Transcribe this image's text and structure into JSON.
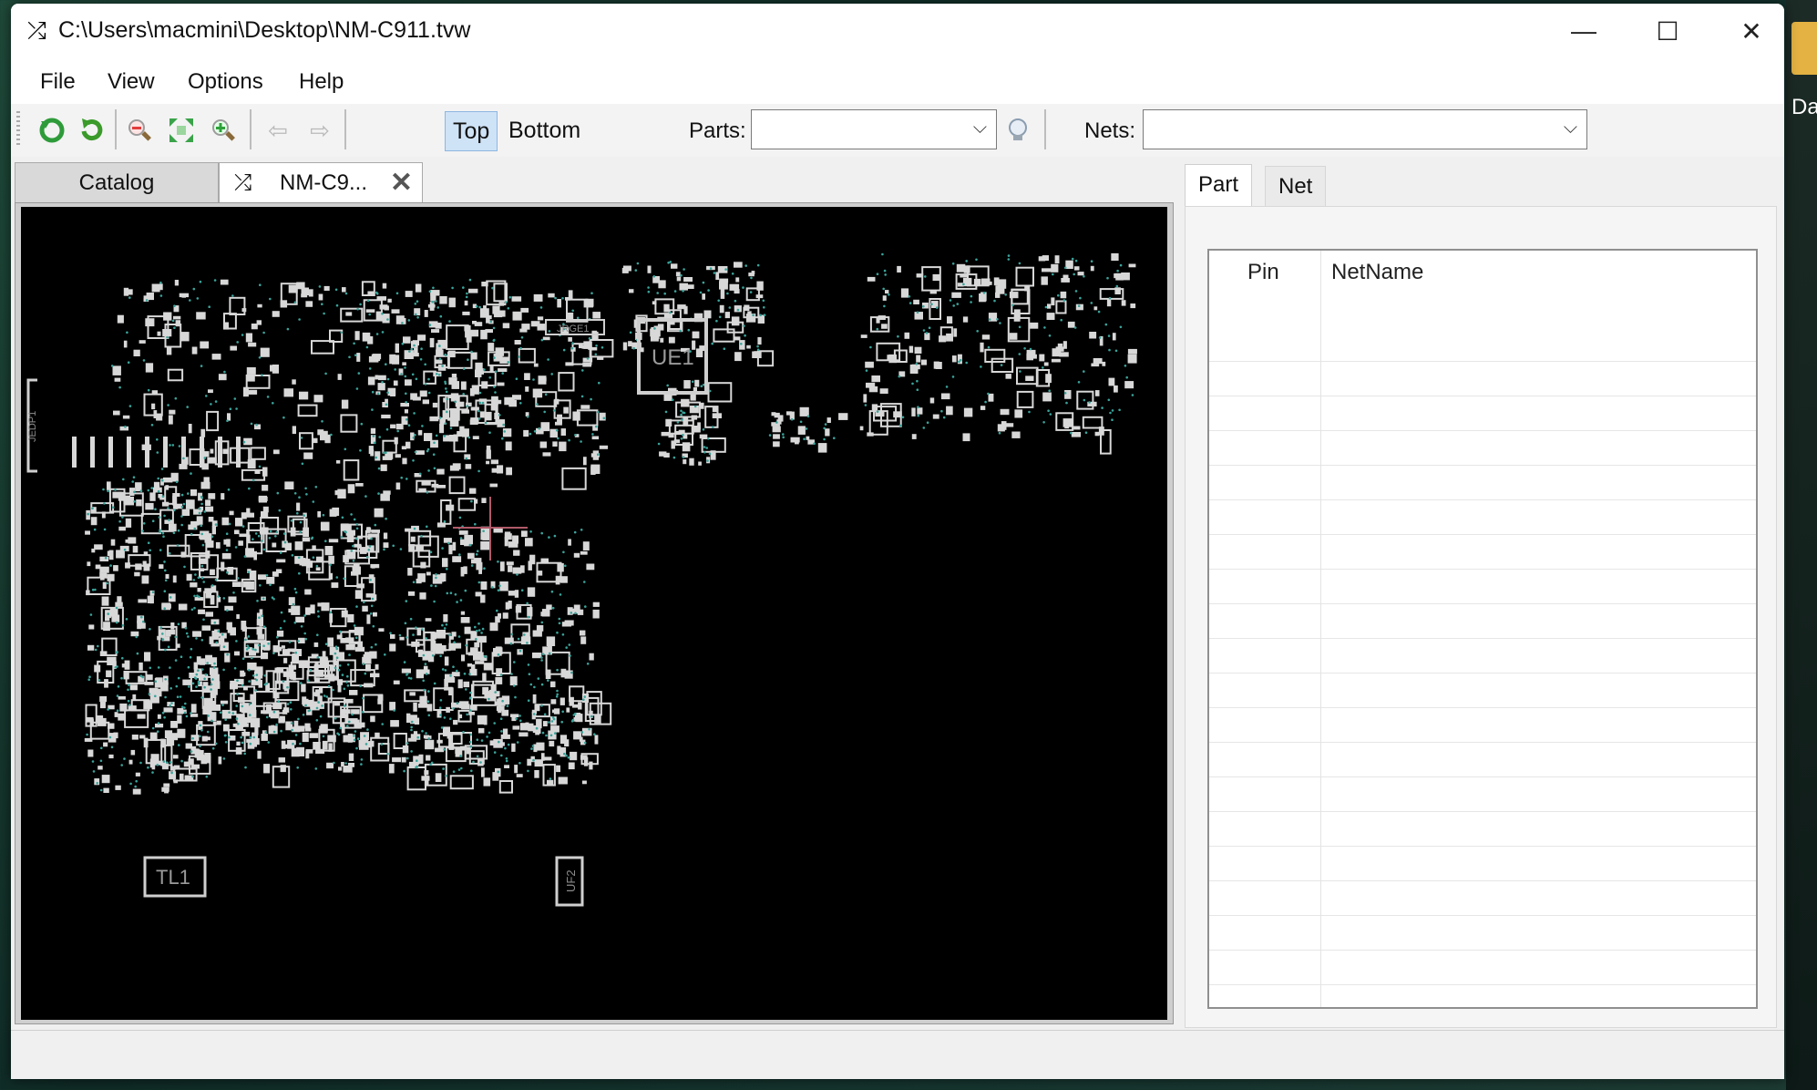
{
  "window": {
    "title": "C:\\Users\\macmini\\Desktop\\NM-C911.tvw",
    "minimize_symbol": "—",
    "maximize_symbol": "☐",
    "close_symbol": "✕"
  },
  "menu": [
    "File",
    "View",
    "Options",
    "Help"
  ],
  "toolbar": {
    "icons": [
      "reload-icon",
      "refresh-icon",
      "zoom-out-icon",
      "fit-icon",
      "zoom-in-icon",
      "back-arrow-icon",
      "forward-arrow-icon",
      "bulb-icon"
    ],
    "side_top": "Top",
    "side_bottom": "Bottom",
    "active_side": "Top",
    "parts_label": "Parts:",
    "parts_value": "",
    "nets_label": "Nets:",
    "nets_value": ""
  },
  "tabs": [
    {
      "label": "Catalog",
      "active": false
    },
    {
      "label": "NM-C9...",
      "active": true
    }
  ],
  "board": {
    "labels": [
      "UE1",
      "TL1",
      "JRGE1",
      "UF2",
      "JEDP1"
    ],
    "background": "#000000",
    "trace_color": "#d8d8d8",
    "via_color": "#3aa39a",
    "cursor_color": "#b05a6a"
  },
  "panel": {
    "tabs": [
      {
        "label": "Part",
        "active": true
      },
      {
        "label": "Net",
        "active": false
      }
    ],
    "columns": [
      "Pin",
      "NetName"
    ]
  },
  "desktop": {
    "partial_label": "Da"
  }
}
